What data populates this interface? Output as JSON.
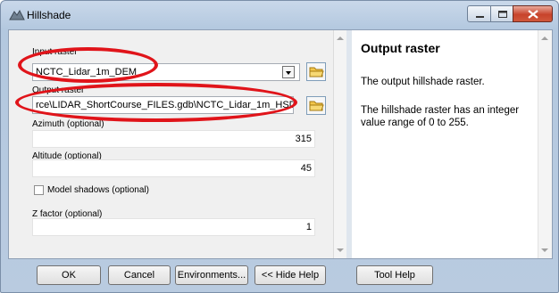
{
  "window": {
    "title": "Hillshade"
  },
  "form": {
    "input_raster": {
      "label": "Input raster",
      "value": "NCTC_Lidar_1m_DEM"
    },
    "output_raster": {
      "label": "Output raster",
      "value": "rce\\LIDAR_ShortCourse_FILES.gdb\\NCTC_Lidar_1m_HSD"
    },
    "azimuth": {
      "label": "Azimuth (optional)",
      "value": "315"
    },
    "altitude": {
      "label": "Altitude (optional)",
      "value": "45"
    },
    "model_shadows": {
      "label": "Model shadows (optional)",
      "checked": false
    },
    "z_factor": {
      "label": "Z factor (optional)",
      "value": "1"
    }
  },
  "help": {
    "title": "Output raster",
    "p1": "The output hillshade raster.",
    "p2": "The hillshade raster has an integer value range of 0 to 255."
  },
  "buttons": {
    "ok": "OK",
    "cancel": "Cancel",
    "environments": "Environments...",
    "hide_help": "<< Hide Help",
    "tool_help": "Tool Help"
  },
  "colors": {
    "annotation": "#e0141a",
    "title_bar": "#b3c8df",
    "close_button": "#c8432b"
  },
  "icons": {
    "window": "hillshade-tool-icon",
    "browse": "folder-icon",
    "dropdown": "chevron-down-icon"
  }
}
